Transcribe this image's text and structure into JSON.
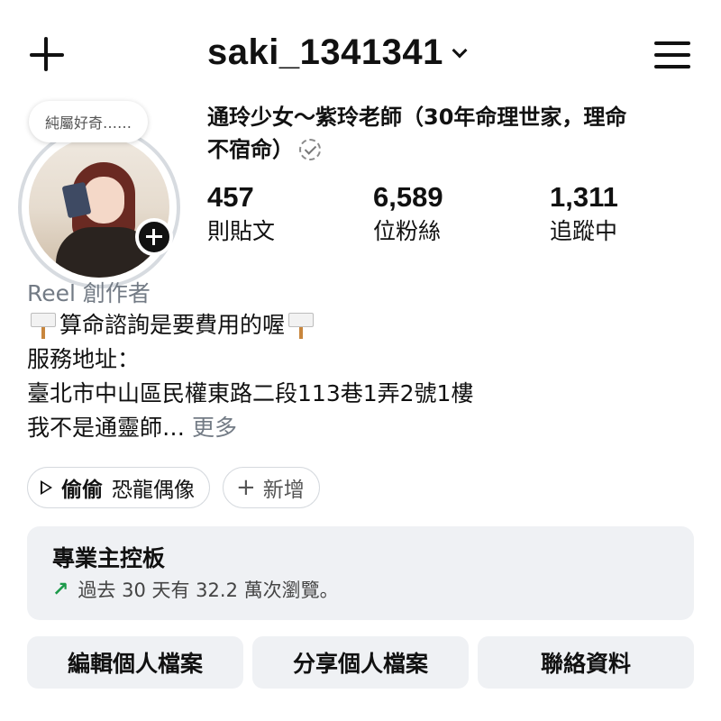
{
  "header": {
    "username": "saki_1341341"
  },
  "profile": {
    "note": "純屬好奇……",
    "display_name": "通玲少女～紫玲老師（30年命理世家，理命不宿命）",
    "stats": [
      {
        "value": "457",
        "label": "則貼文"
      },
      {
        "value": "6,589",
        "label": "位粉絲"
      },
      {
        "value": "1,311",
        "label": "追蹤中"
      }
    ],
    "category": "Reel 創作者",
    "bio": {
      "line1": "算命諮詢是要費用的喔",
      "line2": "服務地址：",
      "line3": "臺北市中山區民權東路二段113巷1弄2號1樓",
      "line4": "我不是通靈師…",
      "more": "更多"
    }
  },
  "chips": {
    "music_artist": "偷偷",
    "music_title": "恐龍偶像",
    "add_label": "新增"
  },
  "dashboard": {
    "title": "專業主控板",
    "subtitle": "過去 30 天有 32.2 萬次瀏覽。",
    "trend_color": "#1c9a4a"
  },
  "actions": {
    "edit": "編輯個人檔案",
    "share": "分享個人檔案",
    "contact": "聯絡資料"
  },
  "icons": [
    "plus-icon",
    "chevron-down-icon",
    "menu-icon",
    "add-story-icon",
    "verified-icon",
    "sign-icon",
    "play-icon",
    "trend-up-icon"
  ]
}
